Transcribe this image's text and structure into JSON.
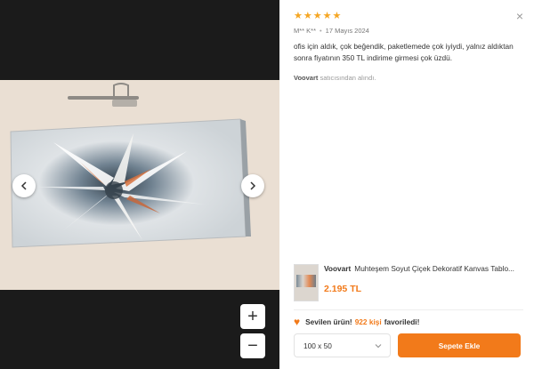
{
  "viewer": {
    "zoom_in_label": "+",
    "zoom_out_label": "−"
  },
  "review": {
    "rating": 5,
    "author": "M** K**",
    "separator": "•",
    "date": "17 Mayıs 2024",
    "text": "ofis için aldık, çok beğendik, paketlemede çok iyiydi, yalnız aldıktan sonra fiyatının 350 TL indirime girmesi çok üzdü.",
    "seller_name": "Voovart",
    "seller_suffix": "satıcısından alındı."
  },
  "product": {
    "brand": "Voovart",
    "title": "Muhteşem Soyut Çiçek Dekoratif Kanvas Tablo...",
    "price": "2.195 TL"
  },
  "favorites": {
    "lead": "Sevilen ürün!",
    "count": "922 kişi",
    "tail": "favoriledi!"
  },
  "size_select": {
    "value": "100 x 50"
  },
  "cart": {
    "add_label": "Sepete Ekle"
  },
  "close_label": "×",
  "colors": {
    "accent": "#f27a1a",
    "star": "#f5a623",
    "viewer_bg": "#1b1b1b"
  },
  "icons": {
    "prev": "chevron-left-icon",
    "next": "chevron-right-icon",
    "close": "close-icon",
    "heart": "heart-icon",
    "dropdown": "chevron-down-icon"
  }
}
